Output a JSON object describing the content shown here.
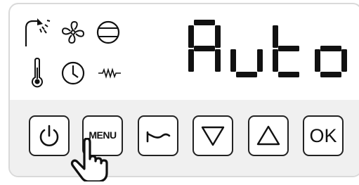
{
  "status_icons": [
    {
      "name": "shower-icon"
    },
    {
      "name": "fan-icon"
    },
    {
      "name": "compressor-icon"
    },
    {
      "name": "thermometer-icon"
    },
    {
      "name": "clock-icon"
    },
    {
      "name": "heater-resistance-icon"
    }
  ],
  "display": {
    "text": "Auto",
    "segment_color": "#111111"
  },
  "buttons": {
    "power_icon": "power-icon",
    "menu_label": "MENU",
    "return_icon": "return-icon",
    "down_icon": "down-triangle-icon",
    "up_icon": "up-triangle-icon",
    "ok_label": "OK"
  },
  "colors": {
    "panel_top": "#ffffff",
    "panel_bottom": "#f0f0f0",
    "border": "#d9d9d9",
    "ink": "#111111"
  }
}
